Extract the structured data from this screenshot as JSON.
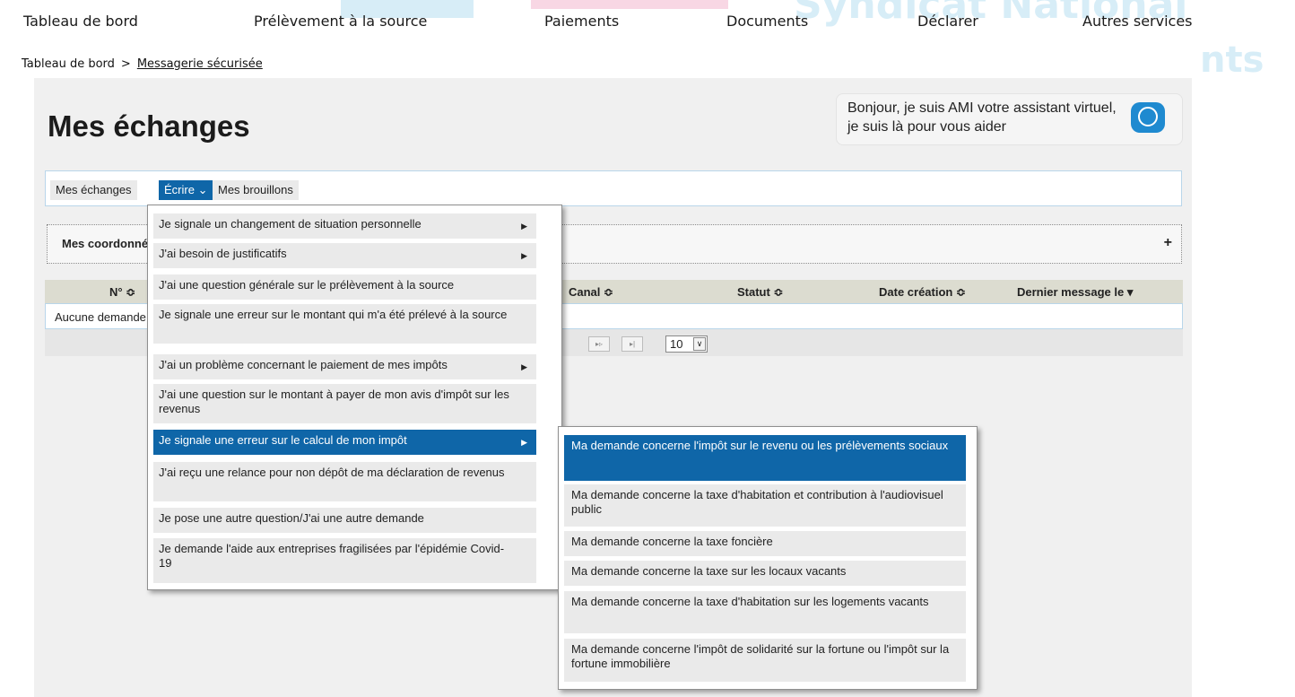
{
  "topnav": [
    {
      "label": "Tableau de bord"
    },
    {
      "label": "Prélèvement à la source"
    },
    {
      "label": "Paiements"
    },
    {
      "label": "Documents"
    },
    {
      "label": "Déclarer"
    },
    {
      "label": "Autres services"
    }
  ],
  "background": {
    "line1": "Syndicat National",
    "line2": "nts"
  },
  "breadcrumb": {
    "home": "Tableau de bord",
    "separator": ">",
    "current": "Messagerie sécurisée"
  },
  "page": {
    "title": "Mes échanges"
  },
  "assistant": {
    "text": "Bonjour, je suis AMI votre assistant virtuel, je suis là pour vous aider"
  },
  "tabs": [
    {
      "label": "Mes échanges"
    },
    {
      "label": "Écrire",
      "caret": "⌄"
    },
    {
      "label": "Mes brouillons"
    }
  ],
  "coordonnees": {
    "label": "Mes coordonnées",
    "plus": "+"
  },
  "table": {
    "columns": [
      {
        "label": "N° ≎"
      },
      {
        "label": "Canal ≎"
      },
      {
        "label": "Statut ≎"
      },
      {
        "label": "Date création ≎"
      },
      {
        "label": "Dernier message le ▾"
      }
    ],
    "empty_text": "Aucune demande"
  },
  "pager": {
    "next": "▸▹",
    "last": "▸|",
    "page_size": "10",
    "page_size_arrow": "∨"
  },
  "menu": {
    "items": [
      {
        "label": "Je signale un changement de situation personnelle",
        "has_sub": true,
        "caret": "▶"
      },
      {
        "label": "J'ai besoin de justificatifs",
        "has_sub": true,
        "caret": "▶"
      },
      {
        "label": "J'ai une question générale sur le prélèvement à la source",
        "has_sub": false
      },
      {
        "label": "Je signale une erreur sur le montant qui m'a été prélevé à la source",
        "has_sub": false
      },
      {
        "label": "J'ai un problème concernant le paiement de mes impôts",
        "has_sub": true,
        "caret": "▶"
      },
      {
        "label": "J'ai une question sur le montant à payer de mon avis d'impôt sur les revenus",
        "has_sub": false
      },
      {
        "label": "Je signale une erreur sur le calcul de mon impôt",
        "has_sub": true,
        "caret": "▶",
        "selected": true
      },
      {
        "label": "J'ai reçu une relance pour non dépôt de ma déclaration de revenus",
        "has_sub": false
      },
      {
        "label": "Je pose une autre question/J'ai une autre demande",
        "has_sub": false
      },
      {
        "label": "Je demande l'aide aux entreprises fragilisées par l'épidémie Covid-19",
        "has_sub": false
      }
    ]
  },
  "submenu": {
    "items": [
      {
        "label": "Ma demande concerne l'impôt sur le revenu ou les prélèvements sociaux",
        "selected": true
      },
      {
        "label": "Ma demande concerne la taxe d'habitation et contribution à l'audiovisuel public"
      },
      {
        "label": "Ma demande concerne la taxe foncière"
      },
      {
        "label": "Ma demande concerne la taxe sur les locaux vacants"
      },
      {
        "label": "Ma demande concerne la taxe d'habitation sur les logements vacants"
      },
      {
        "label": "Ma demande concerne l'impôt de solidarité sur la fortune ou l'impôt sur la fortune immobilière"
      }
    ]
  },
  "colors": {
    "accent": "#0f66a8",
    "panel": "#f0f0f0",
    "header_row": "#dcdcd0",
    "border": "#b9d6ea",
    "assistant_icon": "#1f8ad0"
  }
}
